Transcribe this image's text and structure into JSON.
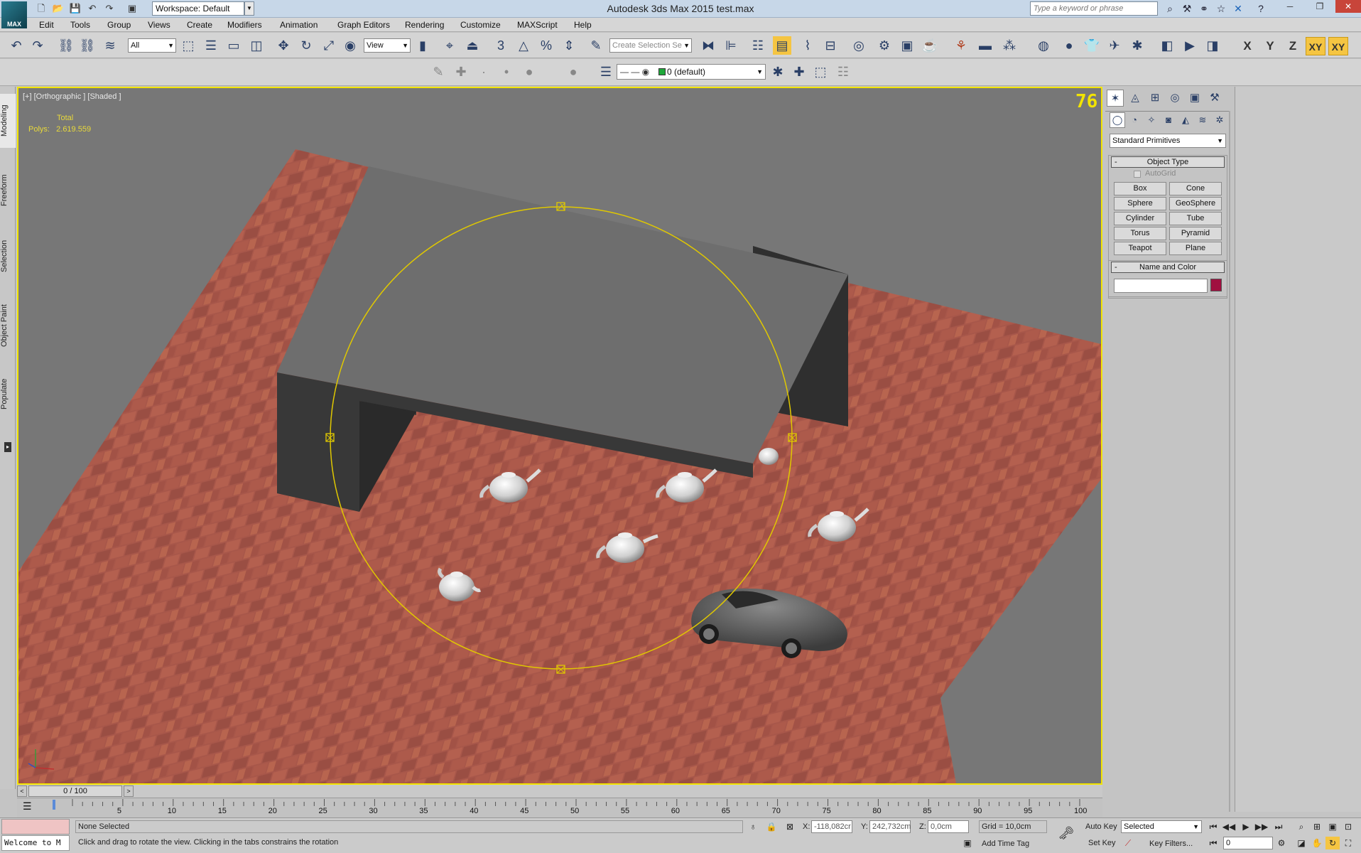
{
  "window": {
    "title": "Autodesk 3ds Max  2015      test.max",
    "logo_text": "MAX",
    "workspace": "Workspace: Default",
    "search_placeholder": "Type a keyword or phrase"
  },
  "menu": [
    "Edit",
    "Tools",
    "Group",
    "Views",
    "Create",
    "Modifiers",
    "Animation",
    "Graph Editors",
    "Rendering",
    "Customize",
    "MAXScript",
    "Help"
  ],
  "toolbar": {
    "selection_filter": "All",
    "reference_coord": "View",
    "named_selection": "Create Selection Se",
    "snap_label": "3",
    "percent_label": "%",
    "axes": [
      "X",
      "Y",
      "Z",
      "XY",
      "XY"
    ]
  },
  "layer_toolbar": {
    "current_layer": "0 (default)"
  },
  "left_tabs": [
    "Modeling",
    "Freeform",
    "Selection",
    "Object Paint",
    "Populate"
  ],
  "viewport": {
    "label": "[+] [Orthographic ] [Shaded ]",
    "stats_header": "Total",
    "stats_label": "Polys:",
    "stats_value": "2.619.559",
    "viewcube": "76"
  },
  "command_panel": {
    "category": "Standard Primitives",
    "object_type_title": "Object Type",
    "autogrid": "AutoGrid",
    "buttons": [
      "Box",
      "Cone",
      "Sphere",
      "GeoSphere",
      "Cylinder",
      "Tube",
      "Torus",
      "Pyramid",
      "Teapot",
      "Plane"
    ],
    "name_color_title": "Name and Color",
    "color": "#a01040"
  },
  "timeline": {
    "frame": "0 / 100",
    "ticks": [
      "5",
      "10",
      "15",
      "20",
      "25",
      "30",
      "35",
      "40",
      "45",
      "50",
      "55",
      "60",
      "65",
      "70",
      "75",
      "80",
      "85",
      "90",
      "95",
      "100"
    ]
  },
  "status": {
    "maxscript_listener": "Welcome to M",
    "selection": "None Selected",
    "prompt": "Click and drag to rotate the view.  Clicking in the tabs constrains the rotation",
    "x_label": "X:",
    "x_value": "-118,082cr",
    "y_label": "Y:",
    "y_value": "242,732cm",
    "z_label": "Z:",
    "z_value": "0,0cm",
    "grid": "Grid = 10,0cm",
    "add_time_tag": "Add Time Tag",
    "auto_key": "Auto Key",
    "set_key": "Set Key",
    "key_mode": "Selected",
    "key_filters": "Key Filters...",
    "current_frame": "0"
  }
}
